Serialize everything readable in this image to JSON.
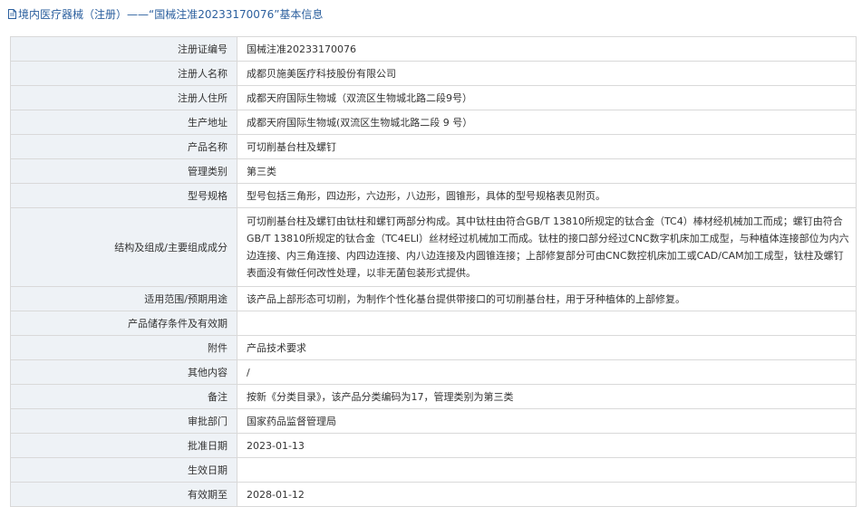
{
  "header": {
    "title": "境内医疗器械（注册）——“国械注准20233170076”基本信息"
  },
  "rows": [
    {
      "label": "注册证编号",
      "value": "国械注准20233170076"
    },
    {
      "label": "注册人名称",
      "value": "成都贝施美医疗科技股份有限公司"
    },
    {
      "label": "注册人住所",
      "value": "成都天府国际生物城（双流区生物城北路二段9号）"
    },
    {
      "label": "生产地址",
      "value": "成都天府国际生物城(双流区生物城北路二段 9 号）"
    },
    {
      "label": "产品名称",
      "value": "可切削基台柱及螺钉"
    },
    {
      "label": "管理类别",
      "value": "第三类"
    },
    {
      "label": "型号规格",
      "value": "型号包括三角形，四边形，六边形，八边形，圆锥形，具体的型号规格表见附页。"
    },
    {
      "label": "结构及组成/主要组成成分",
      "value": "可切削基台柱及螺钉由钛柱和螺钉两部分构成。其中钛柱由符合GB/T 13810所规定的钛合金（TC4）棒材经机械加工而成；螺钉由符合GB/T 13810所规定的钛合金（TC4ELI）丝材经过机械加工而成。钛柱的接口部分经过CNC数字机床加工成型，与种植体连接部位为内六边连接、内三角连接、内四边连接、内八边连接及内圆锥连接；上部修复部分可由CNC数控机床加工或CAD/CAM加工成型，钛柱及螺钉表面没有做任何改性处理，以非无菌包装形式提供。"
    },
    {
      "label": "适用范围/预期用途",
      "value": "该产品上部形态可切削，为制作个性化基台提供带接口的可切削基台柱，用于牙种植体的上部修复。"
    },
    {
      "label": "产品储存条件及有效期",
      "value": ""
    },
    {
      "label": "附件",
      "value": "产品技术要求"
    },
    {
      "label": "其他内容",
      "value": "/"
    },
    {
      "label": "备注",
      "value": "按新《分类目录》，该产品分类编码为17，管理类别为第三类"
    },
    {
      "label": "审批部门",
      "value": "国家药品监督管理局"
    },
    {
      "label": "批准日期",
      "value": "2023-01-13"
    },
    {
      "label": "生效日期",
      "value": ""
    },
    {
      "label": "有效期至",
      "value": "2028-01-12"
    }
  ]
}
